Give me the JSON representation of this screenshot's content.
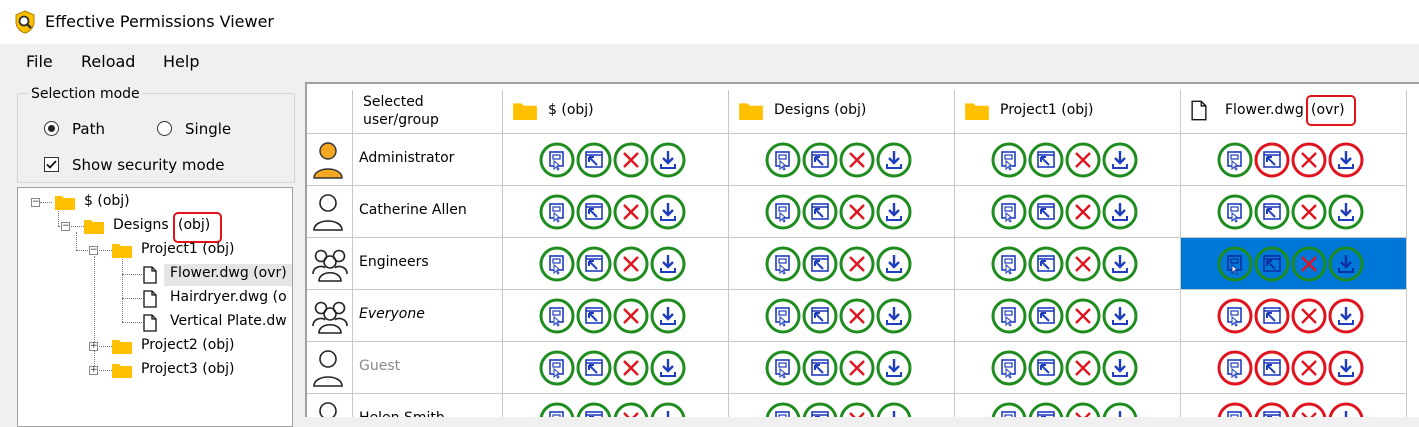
{
  "window": {
    "title": "Effective Permissions Viewer"
  },
  "menu": [
    "File",
    "Reload",
    "Help"
  ],
  "selection_mode": {
    "legend": "Selection mode",
    "options": [
      "Path",
      "Single"
    ],
    "selected": "Path",
    "show_security_label": "Show security mode",
    "show_security_checked": true
  },
  "tree": [
    {
      "label": "$ (obj)",
      "type": "folder",
      "expander": "minus"
    },
    {
      "label": "Designs",
      "suffix": "(obj)",
      "type": "folder",
      "expander": "minus",
      "highlighted_suffix": true
    },
    {
      "label": "Project1 (obj)",
      "type": "folder",
      "expander": "minus"
    },
    {
      "label": "Flower.dwg (ovr)",
      "type": "file",
      "selected": true
    },
    {
      "label": "Hairdryer.dwg (o",
      "type": "file"
    },
    {
      "label": "Vertical Plate.dw",
      "type": "file"
    },
    {
      "label": "Project2 (obj)",
      "type": "folder",
      "expander": "plus"
    },
    {
      "label": "Project3 (obj)",
      "type": "folder",
      "expander": "plus"
    }
  ],
  "grid": {
    "name_header": "Selected user/group",
    "columns": [
      {
        "label": "$ (obj)",
        "icon": "folder"
      },
      {
        "label": "Designs (obj)",
        "icon": "folder"
      },
      {
        "label": "Project1 (obj)",
        "icon": "folder"
      },
      {
        "label": "Flower.dwg",
        "suffix": "(ovr)",
        "icon": "file"
      }
    ],
    "permission_icons": [
      "read-icon",
      "write-icon",
      "delete-icon",
      "download-icon"
    ],
    "rows": [
      {
        "name": "Administrator",
        "kind": "admin",
        "style": "normal",
        "status": [
          [
            "g",
            "g",
            "g",
            "g"
          ],
          [
            "g",
            "g",
            "g",
            "g"
          ],
          [
            "g",
            "g",
            "g",
            "g"
          ],
          [
            "g",
            "r",
            "r",
            "r"
          ]
        ]
      },
      {
        "name": "Catherine Allen",
        "kind": "user",
        "style": "normal",
        "status": [
          [
            "g",
            "g",
            "g",
            "g"
          ],
          [
            "g",
            "g",
            "g",
            "g"
          ],
          [
            "g",
            "g",
            "g",
            "g"
          ],
          [
            "g",
            "g",
            "g",
            "g"
          ]
        ]
      },
      {
        "name": "Engineers",
        "kind": "group",
        "style": "normal",
        "status": [
          [
            "g",
            "g",
            "g",
            "g"
          ],
          [
            "g",
            "g",
            "g",
            "g"
          ],
          [
            "g",
            "g",
            "g",
            "g"
          ],
          [
            "g",
            "g",
            "g",
            "g"
          ]
        ]
      },
      {
        "name": "Everyone",
        "kind": "group",
        "style": "italic",
        "status": [
          [
            "g",
            "g",
            "g",
            "g"
          ],
          [
            "g",
            "g",
            "g",
            "g"
          ],
          [
            "g",
            "g",
            "g",
            "g"
          ],
          [
            "r",
            "r",
            "r",
            "r"
          ]
        ]
      },
      {
        "name": "Guest",
        "kind": "user",
        "style": "grey",
        "status": [
          [
            "g",
            "g",
            "g",
            "g"
          ],
          [
            "g",
            "g",
            "g",
            "g"
          ],
          [
            "g",
            "g",
            "g",
            "g"
          ],
          [
            "r",
            "r",
            "r",
            "r"
          ]
        ]
      },
      {
        "name": "Helen Smith",
        "kind": "user",
        "style": "normal",
        "status": [
          [
            "g",
            "g",
            "g",
            "g"
          ],
          [
            "g",
            "g",
            "g",
            "g"
          ],
          [
            "g",
            "g",
            "g",
            "g"
          ],
          [
            "r",
            "r",
            "r",
            "r"
          ]
        ]
      }
    ],
    "selected_cell": {
      "row": 2,
      "col": 3
    }
  },
  "colors": {
    "allow": "#1e8c1e",
    "deny": "#e0141e",
    "selection": "#0078d7",
    "highlight": "#e2141a",
    "folder": "#ffc000",
    "icon_blue": "#1f3dbf"
  }
}
